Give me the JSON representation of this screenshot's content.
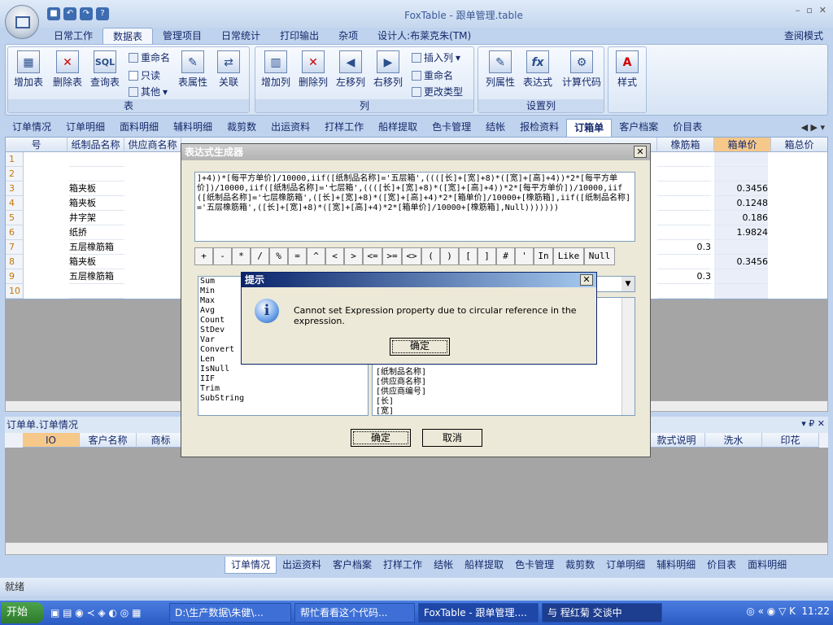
{
  "window": {
    "title": "FoxTable - 跟单管理.table",
    "controls": [
      "–",
      "▫",
      "✕"
    ]
  },
  "menu_tabs": [
    "日常工作",
    "数据表",
    "管理项目",
    "日常统计",
    "打印输出",
    "杂项",
    "设计人:布莱克朱(TM)"
  ],
  "menu_active": "数据表",
  "view_mode": "查阅模式",
  "ribbon": {
    "table_group": {
      "caption": "表",
      "add": "增加表",
      "delete": "删除表",
      "query": "查询表",
      "rename": "重命名",
      "readonly": "只读",
      "other": "其他",
      "props": "表属性",
      "relate": "关联"
    },
    "column_group": {
      "caption": "列",
      "add": "增加列",
      "delete": "删除列",
      "left": "左移列",
      "right": "右移列",
      "insert": "插入列",
      "rename": "重命名",
      "changetype": "更改类型"
    },
    "settings_group": {
      "caption": "设置列",
      "colprops": "列属性",
      "expr": "表达式",
      "calc": "计算代码"
    },
    "style_group": {
      "caption": "",
      "style": "样式"
    }
  },
  "sheet_tabs": [
    "订单情况",
    "订单明细",
    "面料明细",
    "辅料明细",
    "裁剪数",
    "出运资料",
    "打样工作",
    "船样提取",
    "色卡管理",
    "结帐",
    "报检资料",
    "订箱单",
    "客户档案",
    "价目表"
  ],
  "sheet_active": "订箱单",
  "grid": {
    "headers": [
      "纸制品名称",
      "供应商名称",
      "橡筋箱",
      "箱单价",
      "箱总价"
    ],
    "rows": [
      {
        "n": "1",
        "name": "",
        "rubber": "",
        "price": ""
      },
      {
        "n": "2",
        "name": "",
        "rubber": "",
        "price": ""
      },
      {
        "n": "3",
        "name": "箱夹板",
        "rubber": "",
        "price": "0.3456"
      },
      {
        "n": "4",
        "name": "箱夹板",
        "rubber": "",
        "price": "0.1248"
      },
      {
        "n": "5",
        "name": "井字架",
        "rubber": "",
        "price": "0.186"
      },
      {
        "n": "6",
        "name": "纸挢",
        "rubber": "",
        "price": "1.9824"
      },
      {
        "n": "7",
        "name": "五层橡筋箱",
        "rubber": "0.3",
        "price": ""
      },
      {
        "n": "8",
        "name": "箱夹板",
        "rubber": "",
        "price": "0.3456"
      },
      {
        "n": "9",
        "name": "五层橡筋箱",
        "rubber": "0.3",
        "price": ""
      },
      {
        "n": "10",
        "name": "",
        "rubber": "",
        "price": ""
      }
    ]
  },
  "panel2": {
    "title": "订单单.订单情况",
    "headers": [
      "IO",
      "客户名称",
      "商标",
      "款式说明",
      "洗水",
      "印花"
    ]
  },
  "bottom_tabs": [
    "订单情况",
    "出运资料",
    "客户档案",
    "打样工作",
    "结帐",
    "船样提取",
    "色卡管理",
    "裁剪数",
    "订单明细",
    "辅料明细",
    "价目表",
    "面料明细"
  ],
  "bottom_active": "订单情况",
  "status": "就绪",
  "expr_dialog": {
    "title": "表达式生成器",
    "expression": "]+4))*[每平方单价]/10000,iif([纸制品名称]='五层箱',((([长]+[宽]+8)*([宽]+[高]+4))*2*[每平方单价])/10000,iif([纸制品名称]='七层箱',((([长]+[宽]+8)*([宽]+[高]+4))*2*[每平方单价])/10000,iif([纸制品名称]='七层橡筋箱',([长]+[宽]+8)*([宽]+[高]+4)*2*[箱单价]/10000+[橡筋箱],iif([纸制品名称]='五层橡筋箱',([长]+[宽]+8)*([宽]+[高]+4)*2*[箱单价]/10000+[橡筋箱],Null)))))))",
    "ops": [
      "+",
      "-",
      "*",
      "/",
      "%",
      "=",
      "^",
      "<",
      ">",
      "<=",
      ">=",
      "<>",
      "(",
      ")",
      "[",
      "]",
      "#",
      "'",
      "In",
      "Like",
      "Null"
    ],
    "functions": [
      "Sum",
      "Min",
      "Max",
      "Avg",
      "Count",
      "StDev",
      "Var",
      "Convert",
      "Len",
      "IsNull",
      "IIF",
      "Trim",
      "SubString"
    ],
    "fields": [
      "[纸制品名称]",
      "[供应商名称]",
      "[供应商编号]",
      "[长]",
      "[宽]"
    ],
    "ok": "确定",
    "cancel": "取消"
  },
  "alert": {
    "title": "提示",
    "message": "Cannot set Expression property due to circular reference in the expression.",
    "ok": "确定"
  },
  "taskbar": {
    "start": "开始",
    "items": [
      "D:\\生产数据\\朱健\\...",
      "帮忙看看这个代码...",
      "FoxTable - 跟单管理....",
      "与 程红菊 交谈中"
    ],
    "active": 2,
    "clock": "11:22"
  }
}
